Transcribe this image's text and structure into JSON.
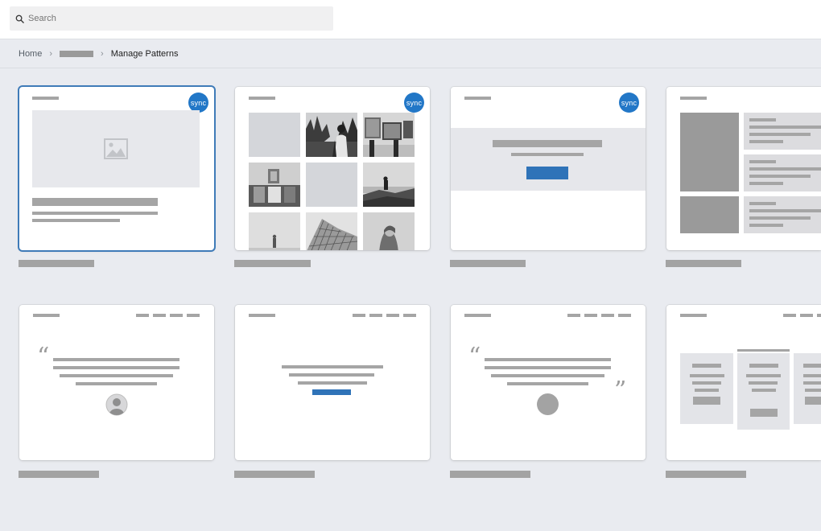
{
  "search": {
    "placeholder": "Search"
  },
  "breadcrumb": {
    "home": "Home",
    "current": "Manage Patterns"
  },
  "patterns": [
    {
      "id": "media-text",
      "synced": true,
      "selected": true
    },
    {
      "id": "gallery",
      "synced": true,
      "selected": false
    },
    {
      "id": "call-to-action",
      "synced": true,
      "selected": false
    },
    {
      "id": "features-list",
      "synced": false,
      "selected": false
    },
    {
      "id": "testimonial-avatar",
      "synced": false,
      "selected": false
    },
    {
      "id": "centered-text-link",
      "synced": false,
      "selected": false
    },
    {
      "id": "quote-with-marks",
      "synced": false,
      "selected": false
    },
    {
      "id": "pricing-table",
      "synced": false,
      "selected": false
    }
  ],
  "badge": {
    "label": "sync"
  },
  "quote": {
    "open": "“",
    "close": "”"
  },
  "icons": {
    "search": "search-icon",
    "image": "image-placeholder-icon",
    "avatar": "avatar-icon",
    "chevron": "chevron-right-icon"
  },
  "colors": {
    "accent": "#2277c7",
    "selection": "#3f7bb8",
    "button": "#2f73b8"
  }
}
